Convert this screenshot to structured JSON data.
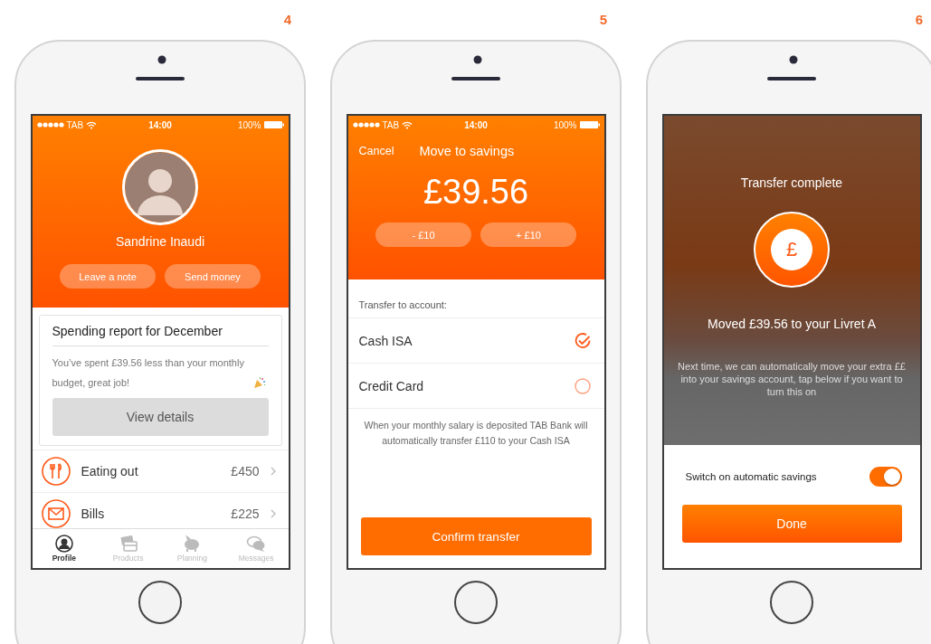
{
  "screens": [
    {
      "kind": "profile",
      "number": "4",
      "status_bar": {
        "carrier": "TAB",
        "time": "14:00",
        "battery": "100%"
      },
      "name": "Sandrine Inaudi",
      "actions": [
        "Leave a note",
        "Send money"
      ],
      "report": {
        "title": "Spending report for December",
        "text": "You’ve spent £39.56 less than your monthly budget, great job!",
        "button": "View details"
      },
      "categories": [
        {
          "kind": "cutlery",
          "label": "Eating out",
          "amount": "£450"
        },
        {
          "kind": "envelope",
          "label": "Bills",
          "amount": "£225"
        }
      ],
      "tabs": [
        {
          "kind": "person",
          "label": "Profile",
          "selected": true
        },
        {
          "kind": "cards",
          "label": "Products",
          "selected": false
        },
        {
          "kind": "piggy",
          "label": "Planning",
          "selected": false
        },
        {
          "kind": "chat",
          "label": "Messages",
          "selected": false
        }
      ]
    },
    {
      "kind": "transfer",
      "number": "5",
      "status_bar": {
        "carrier": "TAB",
        "time": "14:00",
        "battery": "100%"
      },
      "cancel": "Cancel",
      "title": "Move to savings",
      "amount": "£39.56",
      "adjust": [
        "- £10",
        "+ £10"
      ],
      "accounts_label": "Transfer to account:",
      "accounts": [
        {
          "name": "Cash ISA",
          "selected": true
        },
        {
          "name": "Credit Card",
          "selected": false
        }
      ],
      "note": "When your monthly salary is deposited TAB Bank will automatically transfer  £110 to your Cash ISA",
      "confirm": "Confirm transfer"
    },
    {
      "kind": "complete",
      "number": "6",
      "title": "Transfer complete",
      "currency": "£",
      "message": "Moved £39.56 to your Livret A",
      "hint": "Next time, we can automatically move your extra ££ into your savings account, tap below if you want to turn this on",
      "toggle": {
        "label": "Switch on automatic savings",
        "on": true
      },
      "done": "Done"
    }
  ]
}
